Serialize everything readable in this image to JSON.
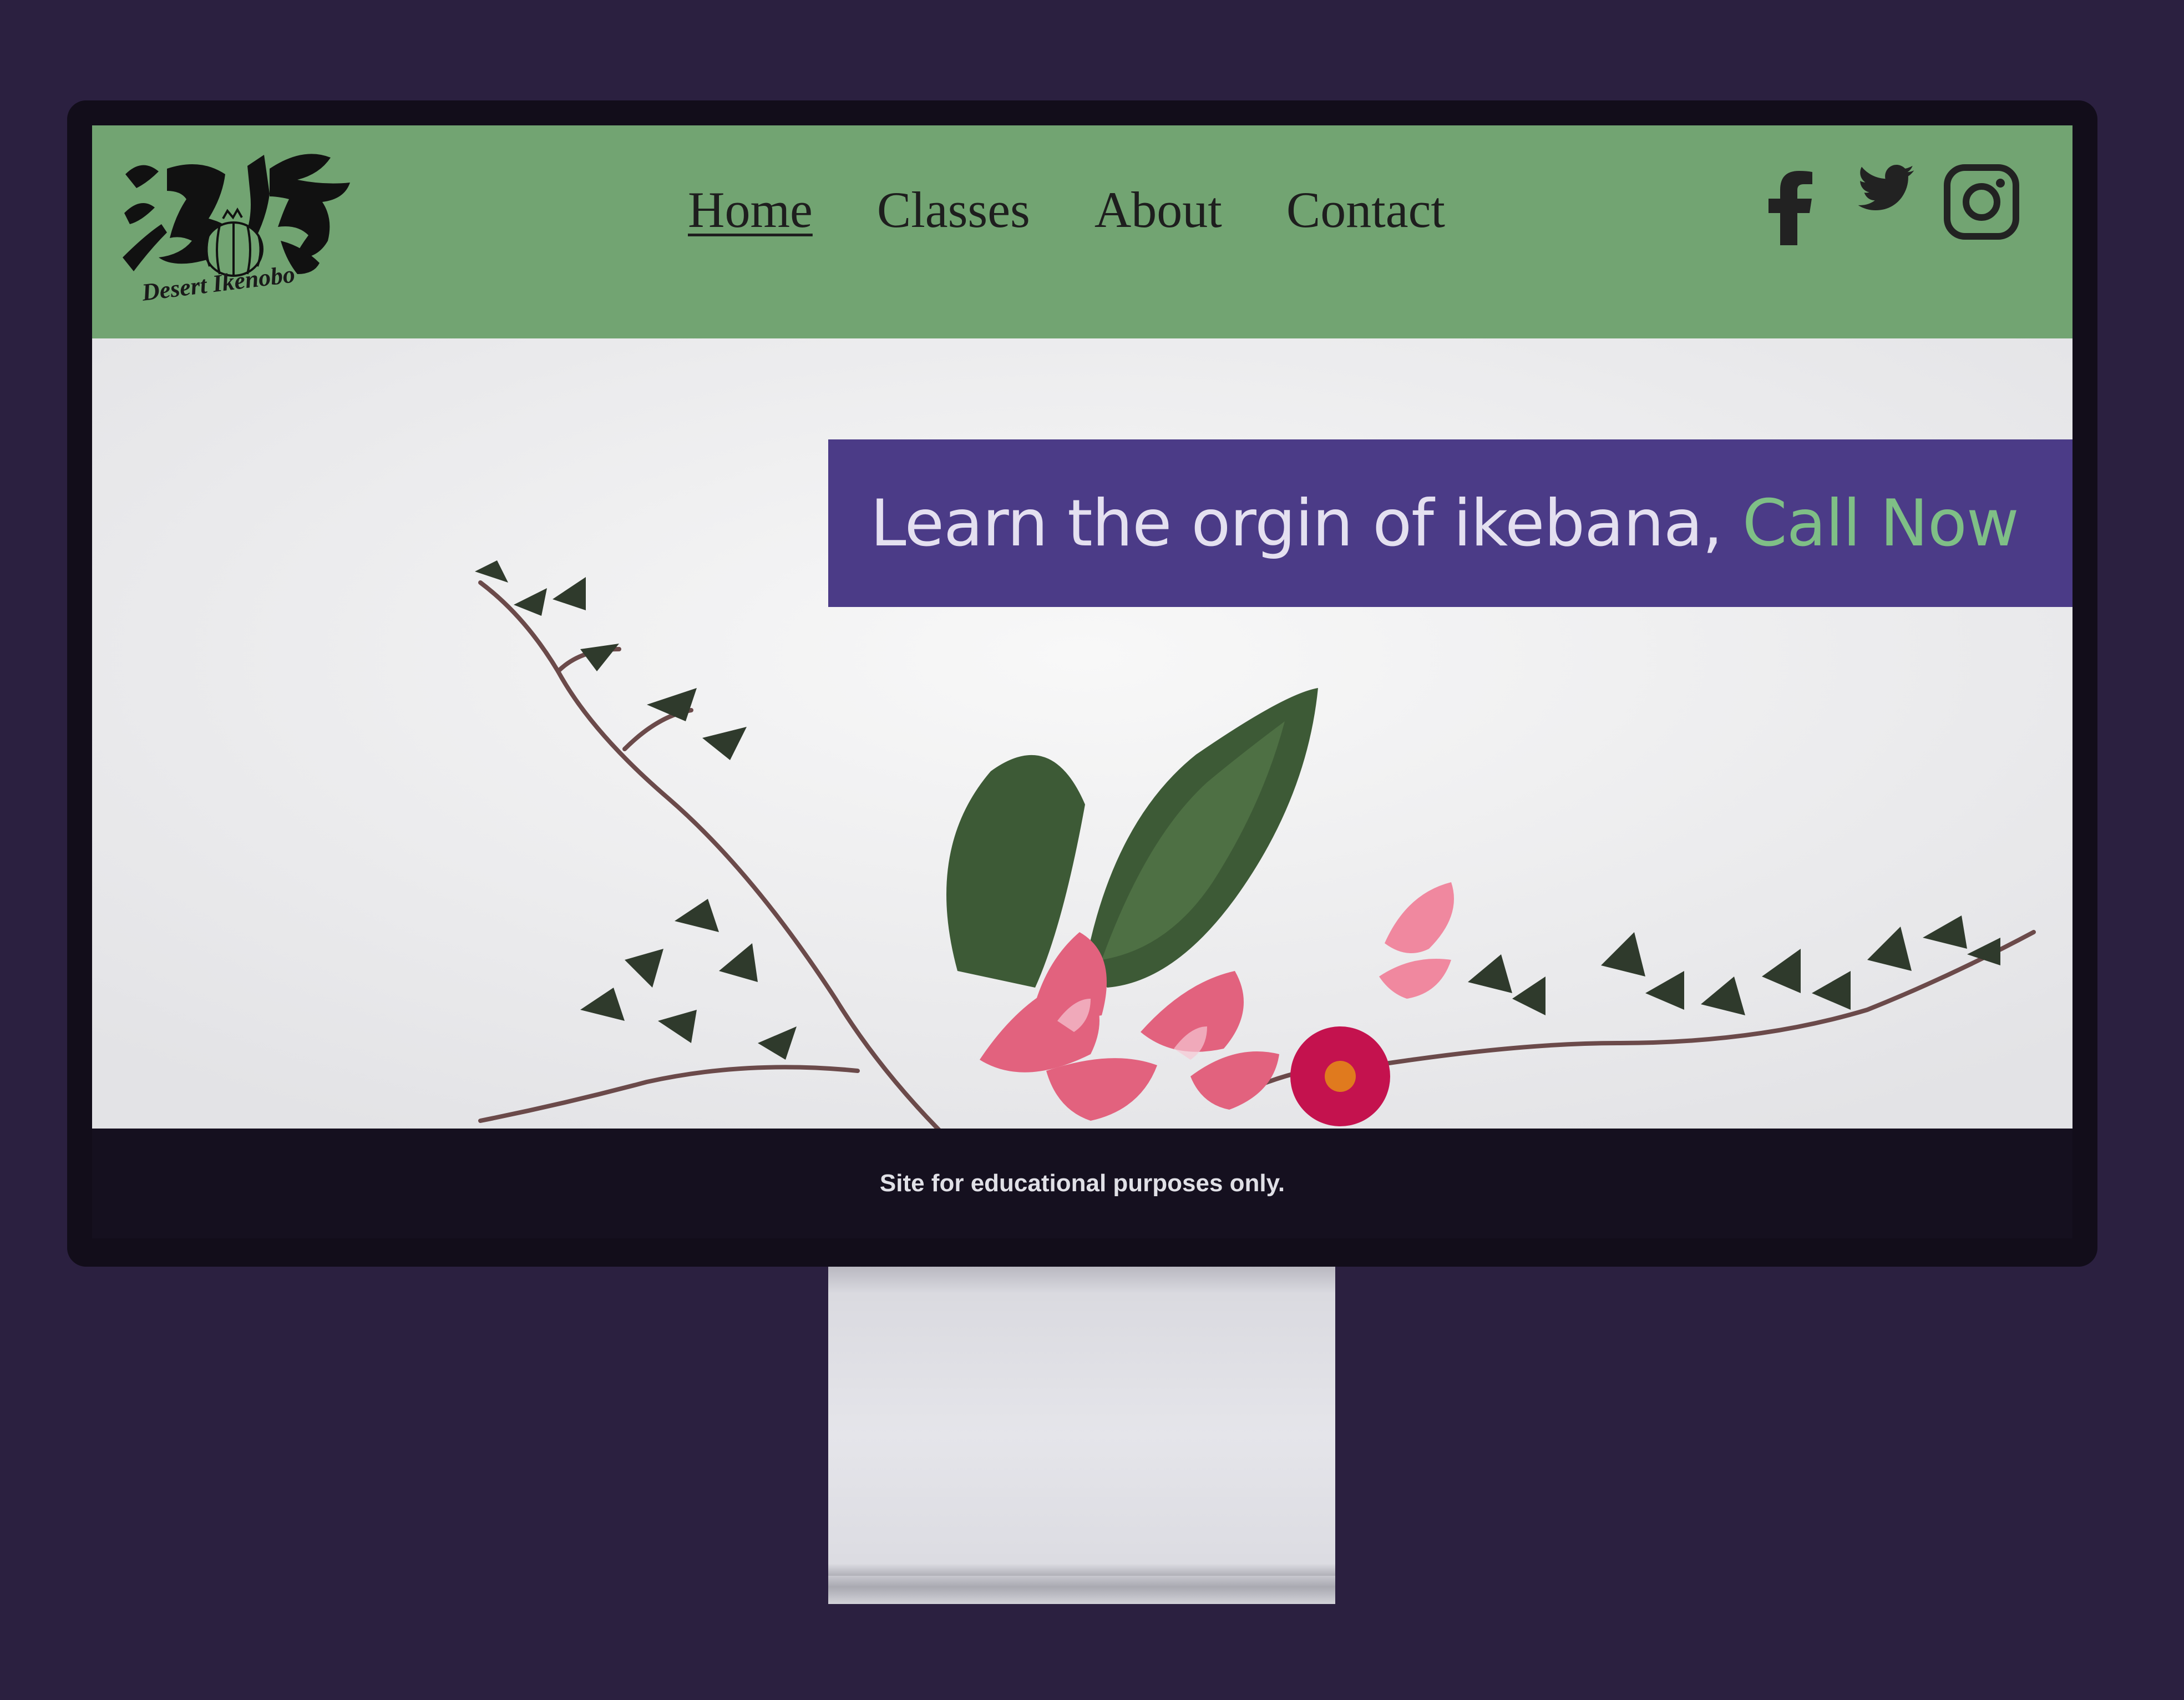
{
  "site": {
    "logo_caption": "Desert Ikenobo",
    "logo_glyphs": "池坊"
  },
  "nav": {
    "items": [
      {
        "label": "Home",
        "active": true
      },
      {
        "label": "Classes",
        "active": false
      },
      {
        "label": "About",
        "active": false
      },
      {
        "label": "Contact",
        "active": false
      }
    ]
  },
  "social": {
    "icons": [
      "facebook-icon",
      "twitter-icon",
      "instagram-icon"
    ]
  },
  "hero": {
    "cta_text": "Learn the orgin of ikebana,",
    "cta_link": "Call Now"
  },
  "footer": {
    "text": "Site for educational purposes only."
  },
  "colors": {
    "header_bg": "#72a472",
    "banner_bg": "#4b3b87",
    "cta_link": "#7fbf86",
    "footer_bg": "#15101f",
    "page_bg": "#2b2040"
  }
}
